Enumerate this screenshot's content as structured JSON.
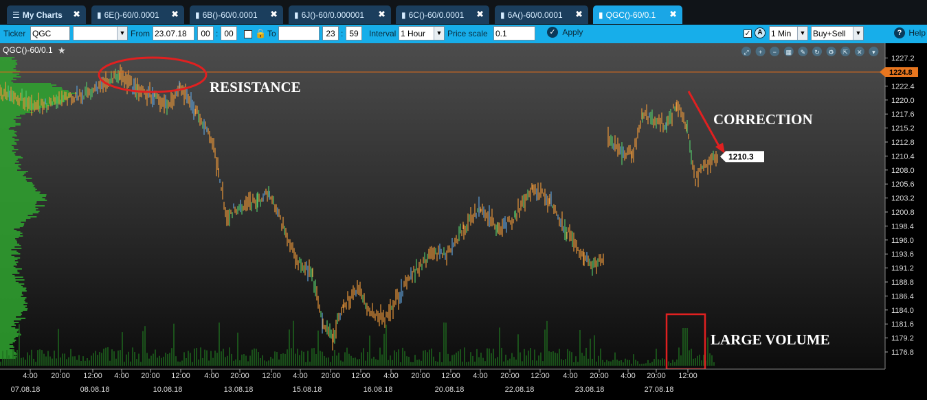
{
  "tabs": [
    {
      "label": "My Charts",
      "icon": "list-icon",
      "active": false
    },
    {
      "label": "6E()-60/0.0001",
      "icon": "bar-chart-icon",
      "active": false
    },
    {
      "label": "6B()-60/0.0001",
      "icon": "bar-chart-icon",
      "active": false
    },
    {
      "label": "6J()-60/0.000001",
      "icon": "bar-chart-icon",
      "active": false
    },
    {
      "label": "6C()-60/0.0001",
      "icon": "bar-chart-icon",
      "active": false
    },
    {
      "label": "6A()-60/0.0001",
      "icon": "bar-chart-icon",
      "active": false
    },
    {
      "label": "QGC()-60/0.1",
      "icon": "bar-chart-icon",
      "active": true
    }
  ],
  "toolbar": {
    "ticker_label": "Ticker",
    "ticker_value": "QGC",
    "ticker_select_value": "",
    "from_label": "From",
    "from_date": "23.07.18",
    "from_hour": "00",
    "from_min": "00",
    "to_label": "To",
    "to_date": "",
    "to_hour": "23",
    "to_min": "59",
    "interval_label": "Interval",
    "interval_value": "1 Hour",
    "price_scale_label": "Price scale",
    "price_scale_value": "0.1",
    "apply_label": "Apply",
    "timeframe_value": "1 Min",
    "side_value": "Buy+Sell",
    "help_label": "Help"
  },
  "chart": {
    "title": "QGC()-60/0.1",
    "last_price_label": "1224.8",
    "current_price_label": "1210.3",
    "annotations": {
      "resistance": "RESISTANCE",
      "correction": "CORRECTION",
      "large_volume": "LARGE VOLUME"
    },
    "toolbar_icons": [
      "zoom-fit-icon",
      "zoom-in-icon",
      "zoom-out-icon",
      "grid-icon",
      "drawing-icon",
      "refresh-icon",
      "settings-icon",
      "export-icon",
      "close-icon",
      "collapse-icon"
    ]
  },
  "chart_data": {
    "type": "bar",
    "title": "QGC()-60/0.1",
    "ylim": [
      1174.8,
      1229.0
    ],
    "y_ticks": [
      "1227.2",
      "1222.4",
      "1220.0",
      "1217.6",
      "1215.2",
      "1212.8",
      "1210.4",
      "1208.0",
      "1205.6",
      "1203.2",
      "1200.8",
      "1198.4",
      "1196.0",
      "1193.6",
      "1191.2",
      "1188.8",
      "1186.4",
      "1184.0",
      "1181.6",
      "1179.2",
      "1176.8"
    ],
    "x_time_ticks": [
      "4:00",
      "20:00",
      "12:00",
      "4:00",
      "20:00",
      "12:00",
      "4:00",
      "20:00",
      "12:00",
      "4:00",
      "20:00",
      "12:00",
      "4:00",
      "20:00",
      "12:00",
      "4:00",
      "20:00",
      "12:00",
      "4:00",
      "20:00",
      "4:00",
      "20:00",
      "12:00"
    ],
    "x_date_ticks": [
      "07.08.18",
      "08.08.18",
      "10.08.18",
      "13.08.18",
      "15.08.18",
      "16.08.18",
      "20.08.18",
      "22.08.18",
      "23.08.18",
      "27.08.18"
    ],
    "resistance_level": 1224.8,
    "last_close": 1210.3,
    "price_path": [
      {
        "seg": 1,
        "points": [
          [
            0,
            1221
          ],
          [
            60,
            1219
          ],
          [
            120,
            1221
          ],
          [
            150,
            1222.5
          ],
          [
            175,
            1224.5
          ],
          [
            200,
            1221.5
          ],
          [
            225,
            1220.5
          ],
          [
            245,
            1219
          ],
          [
            262,
            1222.5
          ],
          [
            285,
            1218
          ],
          [
            305,
            1214
          ],
          [
            318,
            1208
          ],
          [
            330,
            1200
          ],
          [
            350,
            1202
          ],
          [
            375,
            1202.5
          ],
          [
            392,
            1204
          ],
          [
            410,
            1199
          ],
          [
            430,
            1193
          ],
          [
            455,
            1190
          ],
          [
            470,
            1181
          ],
          [
            485,
            1179.5
          ],
          [
            500,
            1184.5
          ],
          [
            520,
            1188
          ],
          [
            540,
            1183.5
          ],
          [
            560,
            1182.5
          ],
          [
            580,
            1186.5
          ],
          [
            600,
            1190
          ],
          [
            630,
            1194
          ],
          [
            650,
            1193.5
          ],
          [
            675,
            1198
          ],
          [
            700,
            1201.5
          ],
          [
            725,
            1198
          ],
          [
            750,
            1200
          ],
          [
            775,
            1205
          ],
          [
            800,
            1203
          ],
          [
            825,
            1197.5
          ],
          [
            850,
            1193
          ],
          [
            860,
            1191.5
          ],
          [
            880,
            1193
          ]
        ]
      },
      {
        "seg": 2,
        "points": [
          [
            885,
            1213
          ],
          [
            905,
            1211
          ],
          [
            920,
            1210.5
          ],
          [
            935,
            1217.5
          ],
          [
            955,
            1216.5
          ],
          [
            970,
            1215.5
          ],
          [
            985,
            1219.5
          ],
          [
            1000,
            1215
          ],
          [
            1012,
            1206.5
          ],
          [
            1030,
            1209
          ],
          [
            1045,
            1210.3
          ]
        ]
      }
    ]
  }
}
